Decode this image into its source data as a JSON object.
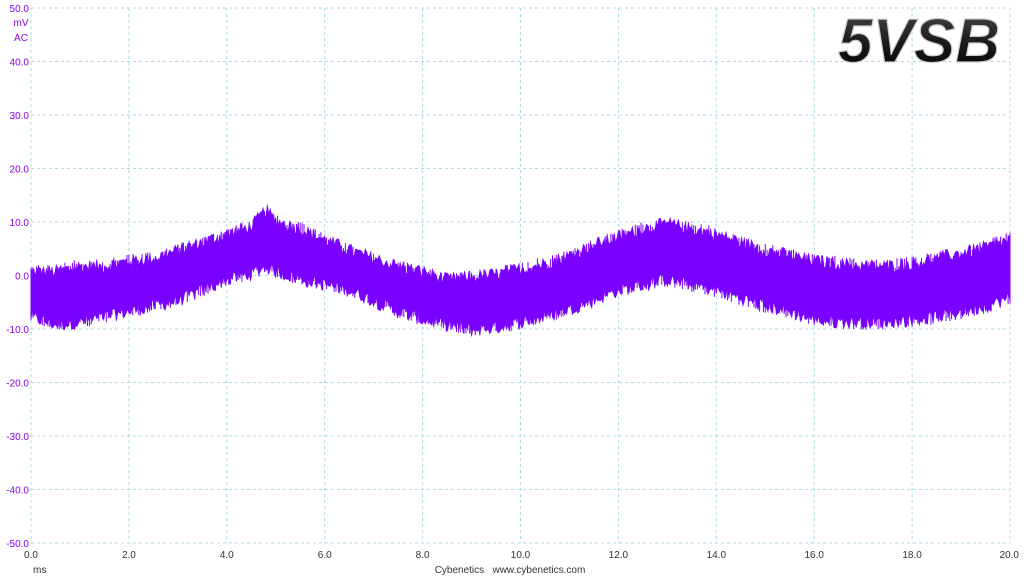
{
  "chart_data": {
    "type": "line",
    "title": "5VSB",
    "ylabel": "mV",
    "ylabel_sub": "AC",
    "xlabel": "ms",
    "credit": "Cybenetics   www.cybenetics.com",
    "xlim": [
      0,
      20
    ],
    "ylim": [
      -50,
      50
    ],
    "x_ticks": [
      0,
      2,
      4,
      6,
      8,
      10,
      12,
      14,
      16,
      18,
      20
    ],
    "x_tick_labels": [
      "0.0",
      "2.0",
      "4.0",
      "6.0",
      "8.0",
      "10.0",
      "12.0",
      "14.0",
      "16.0",
      "18.0",
      "20.0"
    ],
    "y_ticks": [
      50,
      40,
      30,
      20,
      10,
      0,
      -10,
      -20,
      -30,
      -40,
      -50
    ],
    "y_tick_labels": [
      "50.0",
      "40.0",
      "30.0",
      "20.0",
      "10.0",
      "0.0",
      "-10.0",
      "-20.0",
      "-30.0",
      "-40.0",
      "-50.0"
    ],
    "grid": true,
    "series": [
      {
        "color": "#7a00ff",
        "x": [
          0,
          0.5,
          1,
          1.5,
          2,
          2.5,
          3,
          3.5,
          4,
          4.5,
          4.8,
          5,
          5.5,
          6,
          6.5,
          7,
          7.5,
          8,
          8.5,
          9,
          9.5,
          10,
          10.5,
          11,
          11.5,
          12,
          12.5,
          13,
          13.5,
          14,
          14.5,
          15,
          15.5,
          16,
          16.5,
          17,
          17.5,
          18,
          18.5,
          19,
          19.5,
          20
        ],
        "ymax": [
          1,
          1,
          2,
          2,
          3,
          3.5,
          5,
          6.5,
          8,
          9.5,
          12.5,
          10.5,
          9,
          7,
          5,
          3.5,
          2,
          1,
          -0.5,
          0,
          0.5,
          1.5,
          2.5,
          4,
          6,
          7.5,
          9,
          10,
          9,
          8,
          6.5,
          5,
          4,
          3,
          2.5,
          2,
          2,
          2.5,
          3.5,
          4.5,
          5.5,
          7
        ],
        "ymin": [
          -8,
          -9.5,
          -9,
          -8,
          -7,
          -6,
          -5,
          -3,
          -1,
          0,
          1.5,
          0.5,
          -1,
          -2,
          -3,
          -5,
          -7,
          -8.5,
          -9.5,
          -10.5,
          -10,
          -9,
          -8,
          -6.5,
          -5,
          -3,
          -2,
          -1,
          -2,
          -3,
          -4.5,
          -6,
          -7,
          -8.5,
          -9,
          -9,
          -9,
          -8.5,
          -8,
          -7,
          -6,
          -4.5
        ]
      }
    ]
  }
}
